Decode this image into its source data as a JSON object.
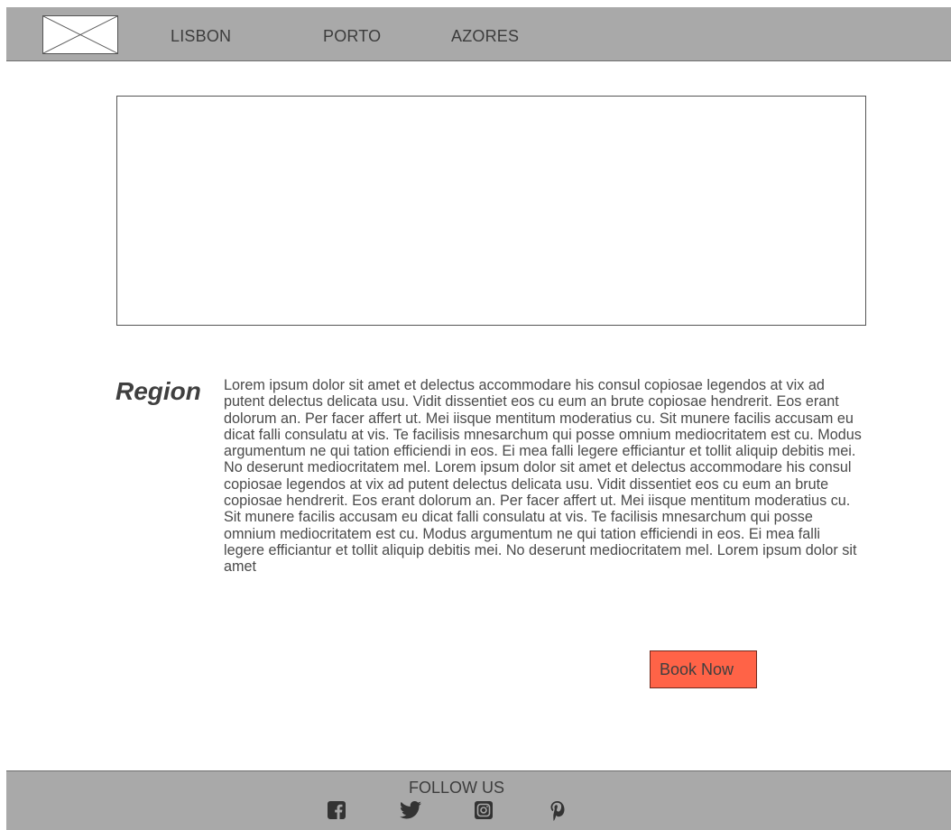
{
  "header": {
    "logo_icon": "image-placeholder-icon",
    "nav": [
      {
        "label": "LISBON"
      },
      {
        "label": "PORTO"
      },
      {
        "label": "AZORES"
      }
    ]
  },
  "hero": {
    "icon": "image-placeholder"
  },
  "region": {
    "title": "Region",
    "body": "Lorem ipsum dolor sit amet et delectus accommodare his consul copiosae legendos at vix ad putent delectus delicata usu. Vidit dissentiet eos cu eum an brute copiosae hendrerit. Eos erant dolorum an. Per facer affert ut. Mei iisque mentitum moderatius cu. Sit munere facilis accusam eu dicat falli consulatu at vis. Te facilisis mnesarchum qui posse omnium mediocritatem est cu. Modus argumentum ne qui tation efficiendi in eos. Ei mea falli legere efficiantur et tollit aliquip debitis mei. No deserunt mediocritatem mel. Lorem ipsum dolor sit amet et delectus accommodare his consul copiosae legendos at vix ad putent delectus delicata usu. Vidit dissentiet eos cu eum an brute copiosae hendrerit. Eos erant dolorum an. Per facer affert ut. Mei iisque mentitum moderatius cu. Sit munere facilis accusam eu dicat falli consulatu at vis. Te facilisis mnesarchum qui posse omnium mediocritatem est cu. Modus argumentum ne qui tation efficiendi in eos. Ei mea falli legere efficiantur et tollit aliquip debitis mei. No deserunt mediocritatem mel. Lorem ipsum dolor sit amet",
    "button_label": "Book Now"
  },
  "footer": {
    "follow_label": "FOLLOW US",
    "social": [
      {
        "icon": "facebook-icon"
      },
      {
        "icon": "twitter-icon"
      },
      {
        "icon": "instagram-icon"
      },
      {
        "icon": "pinterest-icon"
      }
    ]
  },
  "colors": {
    "bar": "#a9a9a9",
    "accent": "#ff6347",
    "text": "#444444"
  }
}
